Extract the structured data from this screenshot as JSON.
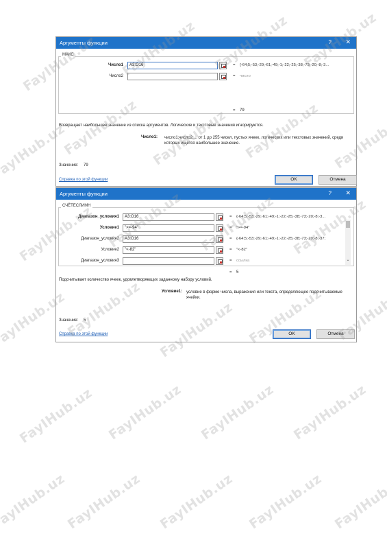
{
  "watermark": "FayIHub.uz",
  "dialog1": {
    "title": "Аргументы функции",
    "help_icon": "?",
    "close_icon": "✕",
    "function_name": "МАКС",
    "args": [
      {
        "label": "Число1",
        "value": "A3:O16",
        "result": "{-64;5;-53;-29;-61;-49;-1;-22;-25;-38;-73;-20;-8;-3..."
      },
      {
        "label": "Число2",
        "value": "",
        "result": "число"
      }
    ],
    "formula_result": "79",
    "description": "Возвращает наибольшее значение из списка аргументов. Логические и текстовые значения игнорируются.",
    "arg_desc_label": "Число1:",
    "arg_desc_text": "число1;число2;... от 1 до 255 чисел, пустых ячеек, логических или текстовых значений, среди которых ищется наибольшее значение.",
    "value_label": "Значение:",
    "value": "79",
    "help_link": "Справка по этой функции",
    "ok_label": "OK",
    "cancel_label": "Отмена"
  },
  "dialog2": {
    "title": "Аргументы функции",
    "help_icon": "?",
    "close_icon": "✕",
    "function_name": "СЧЁТЕСЛИМН",
    "args": [
      {
        "label": "Диапазон_условия1",
        "value": "A3:O16",
        "result": "{-64;5;-53;-29;-61;-49;-1;-22;-25;-38;-73;-20;-8;-3...",
        "bold": true
      },
      {
        "label": "Условие1",
        "value": "\">=-94\"",
        "result": "\">=-94\"",
        "bold": true
      },
      {
        "label": "Диапазон_условия2",
        "value": "A3:O16",
        "result": "{-64;5;-53;-29;-61;-49;-1;-22;-25;-38;-73;-20;-8;-37;",
        "bold": false
      },
      {
        "label": "Условие2",
        "value": "\"<-82\"",
        "result": "\"<-82\"",
        "bold": false
      },
      {
        "label": "Диапазон_условия3",
        "value": "",
        "result": "ссылка",
        "bold": false
      }
    ],
    "formula_result": "5",
    "description": "Подсчитывает количество ячеек, удовлетворяющих заданному набору условий.",
    "arg_desc_label": "Условие1:",
    "arg_desc_text": "условие в форме числа, выражения или текста, определяющее подсчитываемые ячейки.",
    "value_label": "Значение:",
    "value": "5",
    "help_link": "Справка по этой функции",
    "ok_label": "OK",
    "cancel_label": "Отмена"
  }
}
